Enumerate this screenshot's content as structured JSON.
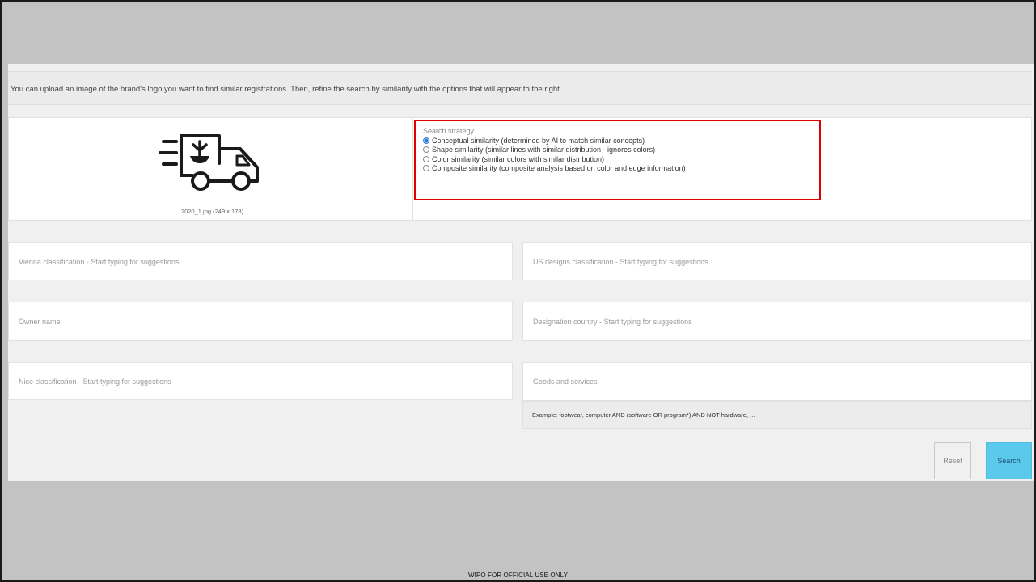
{
  "info_text": "You can upload an image of the brand's logo you want to find similar registrations. Then, refine the search by similarity with the options that will appear to the right.",
  "image": {
    "icon": "delivery-truck-icon",
    "caption": "2020_1.jpg (249 x 178)"
  },
  "strategy": {
    "title": "Search strategy",
    "options": [
      {
        "label": "Conceptual similarity (determined by AI to match similar concepts)",
        "selected": true
      },
      {
        "label": "Shape similarity (similar lines with similar distribution - ignores colors)",
        "selected": false
      },
      {
        "label": "Color similarity (similar colors with similar distribution)",
        "selected": false
      },
      {
        "label": "Composite similarity (composite analysis based on color and edge information)",
        "selected": false
      }
    ]
  },
  "fields": {
    "vienna": "Vienna classification - Start typing for suggestions",
    "us_designs": "US designs classification - Start typing for suggestions",
    "owner": "Owner name",
    "designation": "Designation country - Start typing for suggestions",
    "nice": "Nice classification - Start typing for suggestions",
    "goods": "Goods and services"
  },
  "goods_hint": "Example: footwear, computer AND (software OR program*) AND NOT hardware, ...",
  "buttons": {
    "reset": "Reset",
    "search": "Search"
  },
  "footer": "WIPO FOR OFFICIAL USE ONLY",
  "colors": {
    "accent_red": "#e00000",
    "search_button": "#5bc9ec",
    "radio_selected": "#2b7bd6"
  }
}
